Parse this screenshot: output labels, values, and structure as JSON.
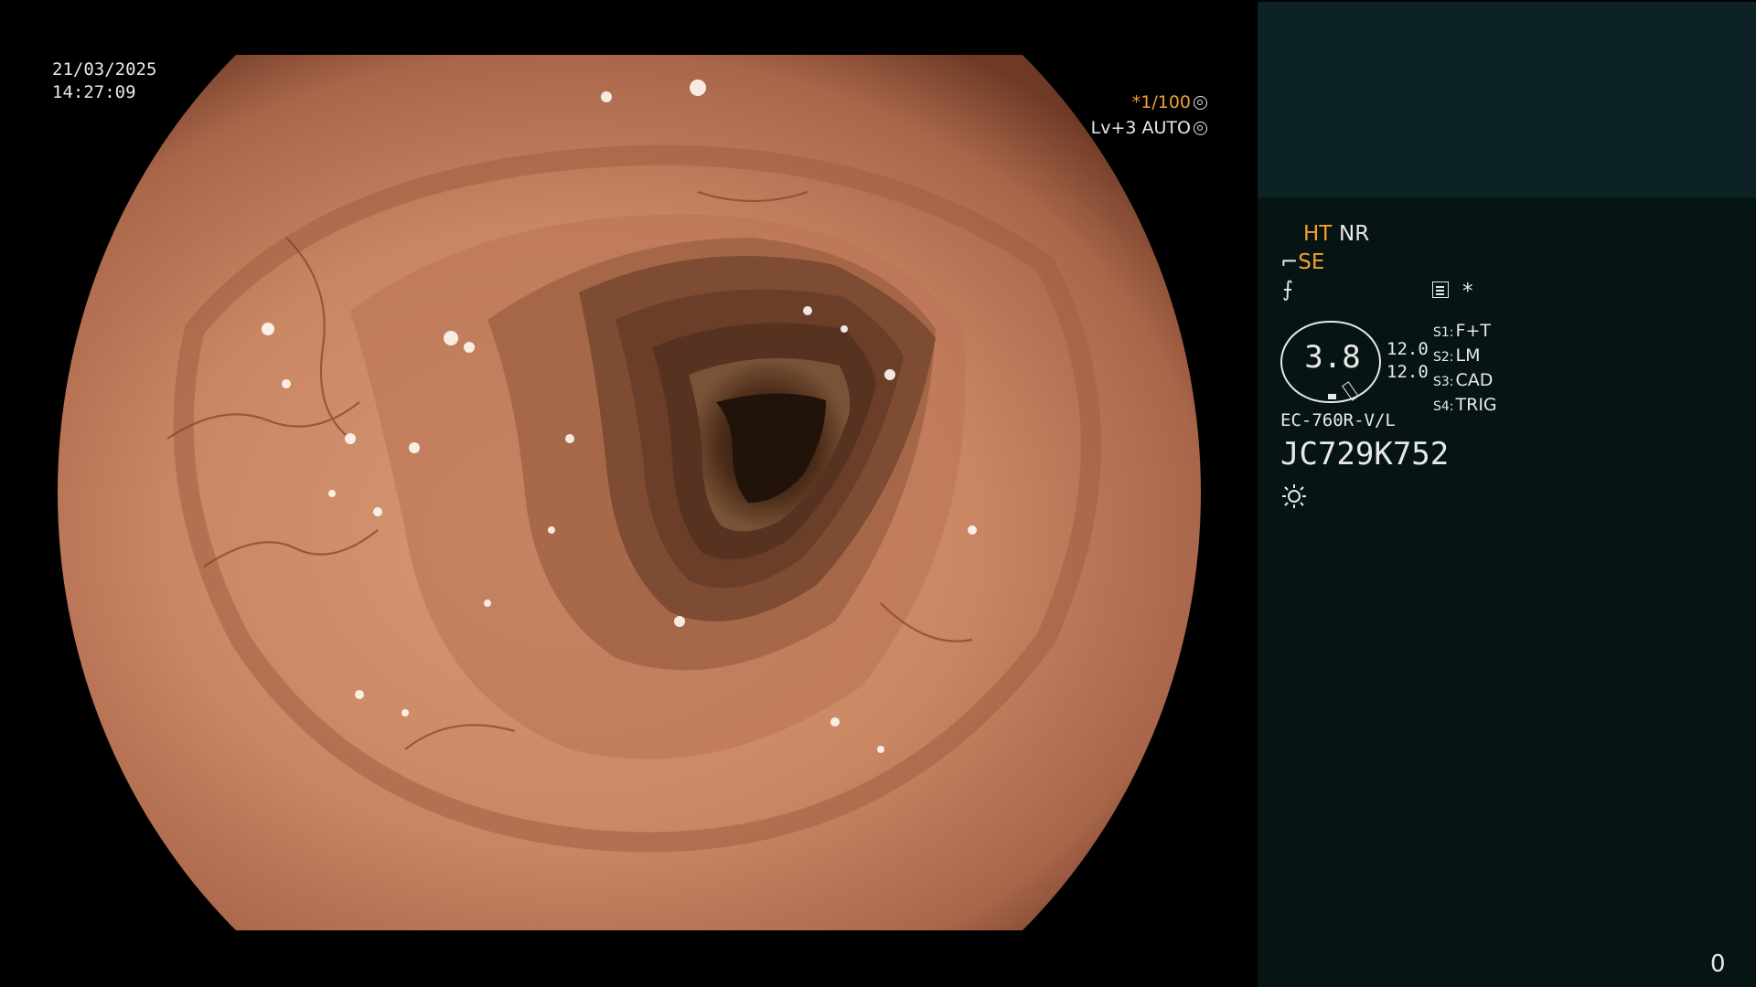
{
  "overlay": {
    "date": "21/03/2025",
    "time": "14:27:09",
    "shutter_prefix": "*1/100",
    "light_level": "Lv+3",
    "iris_mode": "AUTO"
  },
  "panel": {
    "ht": "HT",
    "nr": "NR",
    "se": "SE",
    "star": "*",
    "zoom": "3.8",
    "stat_1": "12.0",
    "stat_2": "12.0",
    "switches": [
      {
        "key": "S1:",
        "value": "F+T"
      },
      {
        "key": "S2:",
        "value": "LM"
      },
      {
        "key": "S3:",
        "value": "CAD"
      },
      {
        "key": "S4:",
        "value": "TRIG"
      }
    ],
    "model": "EC-760R-V/L",
    "serial": "JC729K752",
    "counter": "0"
  },
  "colors": {
    "accent": "#f0a030",
    "text": "#e8e8e8",
    "panel_top": "#0d2224",
    "panel_bottom": "#071414",
    "mucosa": "#c98a66",
    "lumen": "#3a2214"
  },
  "icons": {
    "shutter": "shutter-icon",
    "iris": "iris-icon",
    "scope_tip": "scope-tip-icon",
    "freeze": "freeze-icon",
    "memo": "memo-icon",
    "light": "light-icon"
  }
}
